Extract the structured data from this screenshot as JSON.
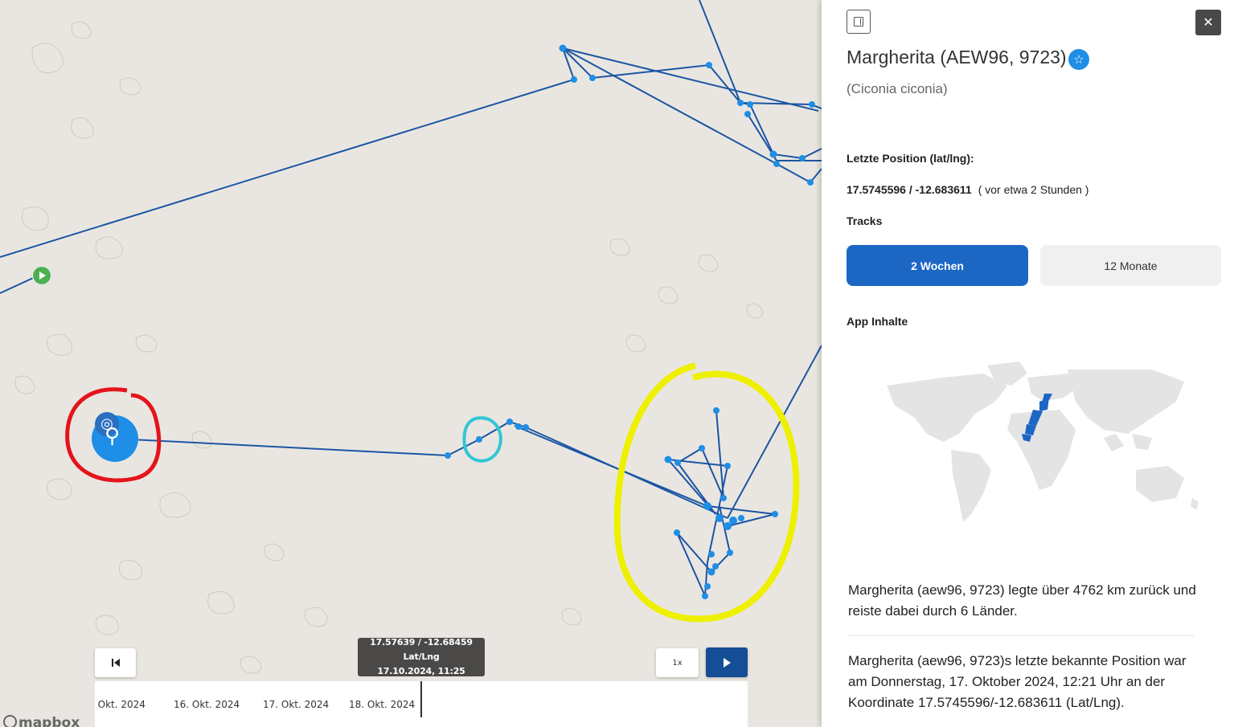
{
  "map": {
    "tooltip_coords": "17.57639 / -12.68459 Lat/Lng",
    "tooltip_time": "17.10.2024, 11:25",
    "speed_label": "1x",
    "timeline_labels": [
      ". Okt. 2024",
      "16. Okt. 2024",
      "17. Okt. 2024",
      "18. Okt. 2024"
    ],
    "attribution": "mapbox",
    "track_color": "#1b55a3",
    "point_color": "#1f8ee6"
  },
  "panel": {
    "name": "Margherita (AEW96, 9723)",
    "species": "(Ciconia ciconia)",
    "last_position_label": "Letzte Position (lat/lng):",
    "last_position_value": "17.5745596 / -12.683611",
    "last_position_ago": "( vor etwa 2 Stunden )",
    "tracks_label": "Tracks",
    "track_buttons": [
      "2 Wochen",
      "12 Monate"
    ],
    "active_track": "2 Wochen",
    "app_content_label": "App Inhalte",
    "summary_text": "Margherita (aew96, 9723) legte über 4762 km zurück und reiste dabei durch 6 Länder.",
    "last_known_text": "Margherita (aew96, 9723)s letzte bekannte Position war am Donnerstag, 17. Oktober 2024, 12:21 Uhr an der Koordinate 17.5745596/-12.683611 (Lat/Lng).",
    "close_icon": "close-icon",
    "favorite_icon": "star-icon"
  }
}
